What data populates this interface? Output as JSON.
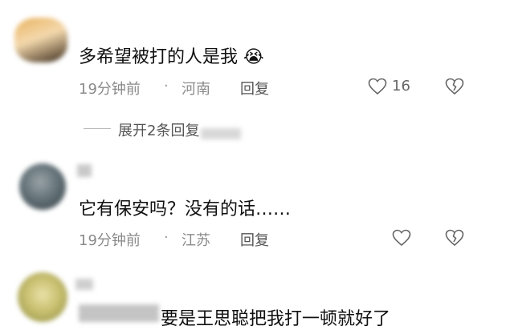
{
  "comments": [
    {
      "text": "多希望被打的人是我",
      "emoji": "😭",
      "time": "19分钟前",
      "location": "河南",
      "reply_label": "回复",
      "likes": "16",
      "expand_label": "展开2条回复"
    },
    {
      "text": "它有保安吗？没有的话……",
      "time": "19分钟前",
      "location": "江苏",
      "reply_label": "回复"
    },
    {
      "text": "要是王思聪把我打一顿就好了"
    }
  ]
}
